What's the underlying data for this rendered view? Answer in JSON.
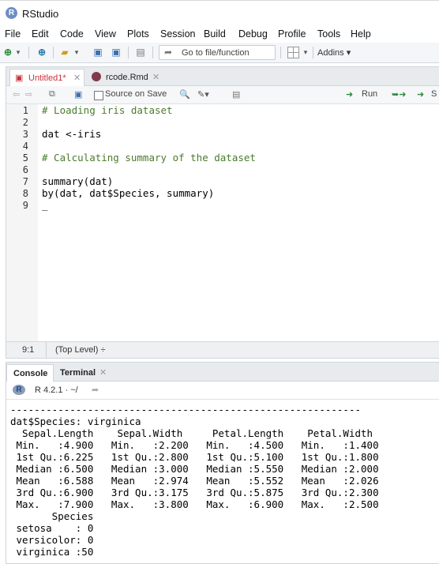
{
  "window": {
    "title": "RStudio",
    "logo_letter": "R"
  },
  "menu": [
    "File",
    "Edit",
    "Code",
    "View",
    "Plots",
    "Session",
    "Build",
    "Debug",
    "Profile",
    "Tools",
    "Help"
  ],
  "toolbar": {
    "goto_placeholder": "Go to file/function",
    "addins_label": "Addins"
  },
  "editor": {
    "tabs": [
      {
        "label": "Untitled1*",
        "active": true
      },
      {
        "label": "rcode.Rmd",
        "active": false
      }
    ],
    "source_on_save": "Source on Save",
    "run_label": "Run",
    "source_label": "S",
    "line_numbers": [
      "1",
      "2",
      "3",
      "4",
      "5",
      "6",
      "7",
      "8",
      "9"
    ],
    "lines": [
      {
        "text": "# Loading iris dataset",
        "type": "comment"
      },
      {
        "text": "",
        "type": "code"
      },
      {
        "text": "dat <-iris",
        "type": "code"
      },
      {
        "text": "",
        "type": "code"
      },
      {
        "text": "# Calculating summary of the dataset",
        "type": "comment"
      },
      {
        "text": "",
        "type": "code"
      },
      {
        "text": "summary(dat)",
        "type": "code"
      },
      {
        "text": "by(dat, dat$Species, summary)",
        "type": "code"
      },
      {
        "text": "_",
        "type": "code"
      }
    ],
    "cursor_pos": "9:1",
    "scope": "(Top Level) ÷"
  },
  "console": {
    "tabs": [
      {
        "label": "Console",
        "active": true
      },
      {
        "label": "Terminal",
        "active": false
      }
    ],
    "r_version": "R 4.2.1 · ~/",
    "output": [
      "-----------------------------------------------------------",
      "dat$Species: virginica",
      "  Sepal.Length    Sepal.Width     Petal.Length    Petal.Width",
      " Min.   :4.900   Min.   :2.200   Min.   :4.500   Min.   :1.400",
      " 1st Qu.:6.225   1st Qu.:2.800   1st Qu.:5.100   1st Qu.:1.800",
      " Median :6.500   Median :3.000   Median :5.550   Median :2.000",
      " Mean   :6.588   Mean   :2.974   Mean   :5.552   Mean   :2.026",
      " 3rd Qu.:6.900   3rd Qu.:3.175   3rd Qu.:5.875   3rd Qu.:2.300",
      " Max.   :7.900   Max.   :3.800   Max.   :6.900   Max.   :2.500",
      "       Species",
      " setosa    : 0",
      " versicolor: 0",
      " virginica :50"
    ]
  }
}
